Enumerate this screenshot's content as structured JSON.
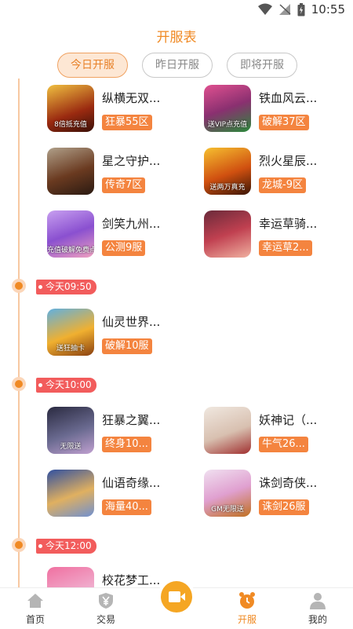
{
  "status_bar": {
    "time": "10:55"
  },
  "page_title": "开服表",
  "tabs": [
    {
      "label": "今日开服",
      "active": true
    },
    {
      "label": "昨日开服",
      "active": false
    },
    {
      "label": "即将开服",
      "active": false
    }
  ],
  "sections": [
    {
      "time": "",
      "games": [
        {
          "name": "纵横无双...",
          "server": "狂暴55区",
          "thumb_text": "8倍抵充值"
        },
        {
          "name": "铁血风云...",
          "server": "破解37区",
          "thumb_text": "送VIP点充值"
        },
        {
          "name": "星之守护...",
          "server": "传奇7区",
          "thumb_text": ""
        },
        {
          "name": "烈火星辰...",
          "server": "龙城-9区",
          "thumb_text": "送两万真充"
        },
        {
          "name": "剑笑九州...",
          "server": "公测9服",
          "thumb_text": "充值破解免费点"
        },
        {
          "name": "幸运草骑...",
          "server": "幸运草2...",
          "thumb_text": ""
        }
      ]
    },
    {
      "time": "今天09:50",
      "games": [
        {
          "name": "仙灵世界...",
          "server": "破解10服",
          "thumb_text": "送狂抽卡"
        }
      ]
    },
    {
      "time": "今天10:00",
      "games": [
        {
          "name": "狂暴之翼...",
          "server": "终身10...",
          "thumb_text": "无限送"
        },
        {
          "name": "妖神记（...",
          "server": "牛气26...",
          "thumb_text": ""
        },
        {
          "name": "仙语奇缘...",
          "server": "海量40...",
          "thumb_text": ""
        },
        {
          "name": "诛剑奇侠...",
          "server": "诛剑26服",
          "thumb_text": "GM无限送"
        }
      ]
    },
    {
      "time": "今天12:00",
      "games": [
        {
          "name": "校花梦工...",
          "server": "",
          "thumb_text": ""
        }
      ]
    }
  ],
  "bottom_nav": [
    {
      "label": "首页",
      "icon": "home-icon"
    },
    {
      "label": "交易",
      "icon": "yen-shield-icon"
    },
    {
      "label": "",
      "icon": "video-camera-icon"
    },
    {
      "label": "开服",
      "icon": "alarm-clock-icon",
      "active": true
    },
    {
      "label": "我的",
      "icon": "user-icon"
    }
  ],
  "colors": {
    "accent": "#f08a24",
    "server_badge": "#f4843f",
    "time_badge": "#f25c5c",
    "active_tab_bg": "#fde7d4"
  }
}
